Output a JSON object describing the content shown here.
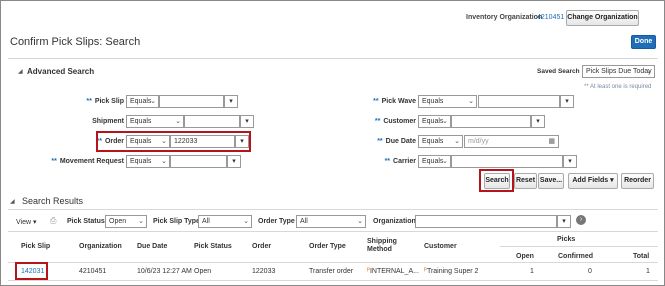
{
  "header": {
    "org_label": "Inventory Organization",
    "org_value": "4210451",
    "change_org_button": "Change Organization",
    "page_title": "Confirm Pick Slips: Search",
    "done_button": "Done"
  },
  "advanced_search": {
    "title": "Advanced Search",
    "saved_search_label": "Saved Search",
    "saved_search_value": "Pick Slips Due Today",
    "required_note": "** At least one is required",
    "left_fields": [
      {
        "label": "Pick Slip",
        "operator": "Equals",
        "value": "",
        "required": true
      },
      {
        "label": "Shipment",
        "operator": "Equals",
        "value": "",
        "required": false
      },
      {
        "label": "Order",
        "operator": "Equals",
        "value": "122033",
        "required": true
      },
      {
        "label": "Movement Request",
        "operator": "Equals",
        "value": "",
        "required": true
      }
    ],
    "right_fields": [
      {
        "label": "Pick Wave",
        "operator": "Equals",
        "value": "",
        "required": true
      },
      {
        "label": "Customer",
        "operator": "Equals",
        "value": "",
        "required": true
      },
      {
        "label": "Due Date",
        "operator": "Equals",
        "value": "",
        "placeholder": "m/d/yy",
        "required": true
      },
      {
        "label": "Carrier",
        "operator": "Equals",
        "value": "",
        "required": true
      }
    ],
    "required_mark": "**",
    "buttons": {
      "search": "Search",
      "reset": "Reset",
      "save": "Save...",
      "add_fields": "Add Fields",
      "reorder": "Reorder"
    }
  },
  "results": {
    "title": "Search Results",
    "view_label": "View",
    "pick_status_label": "Pick Status",
    "pick_status_value": "Open",
    "pick_slip_type_label": "Pick Slip Type",
    "pick_slip_type_value": "All",
    "order_type_label": "Order Type",
    "order_type_value": "All",
    "organization_label": "Organization",
    "organization_value": "",
    "columns": [
      "Pick Slip",
      "Organization",
      "Due Date",
      "Pick Status",
      "Order",
      "Order Type",
      "Shipping Method",
      "Customer"
    ],
    "picks_group": "Picks",
    "picks_columns": [
      "Open",
      "Confirmed",
      "Total"
    ],
    "rows": [
      {
        "pick_slip": "142031",
        "organization": "4210451",
        "due_date": "10/6/23 12:27 AM",
        "pick_status": "Open",
        "order": "122033",
        "order_type": "Transfer order",
        "shipping_method": "INTERNAL_A...",
        "customer": "Training Super 2",
        "open": "1",
        "confirmed": "0",
        "total": "1"
      }
    ]
  },
  "colors": {
    "accent": "#1a6fb7",
    "highlight": "#b4151b",
    "done_button": "#1f6fb8"
  }
}
